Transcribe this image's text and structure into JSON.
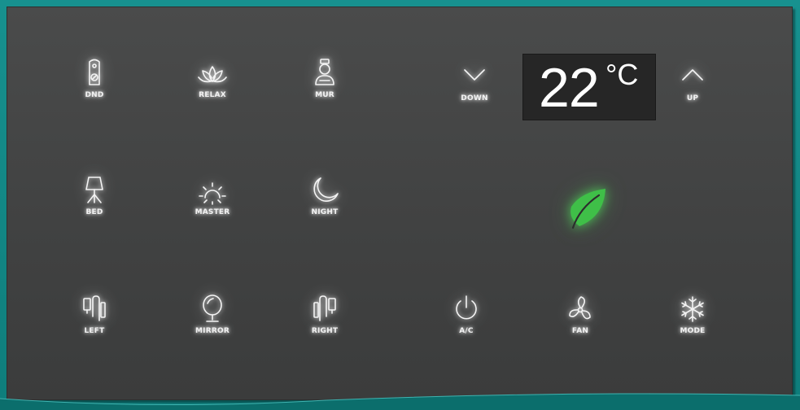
{
  "panel": {
    "lighting": {
      "dnd": {
        "label": "DND",
        "icon": "do-not-disturb-icon"
      },
      "relax": {
        "label": "RELAX",
        "icon": "lotus-icon"
      },
      "mur": {
        "label": "MUR",
        "icon": "housekeeping-icon"
      },
      "bed": {
        "label": "BED",
        "icon": "table-lamp-icon"
      },
      "master": {
        "label": "MASTER",
        "icon": "sun-icon"
      },
      "night": {
        "label": "NIGHT",
        "icon": "crescent-moon-icon"
      },
      "left": {
        "label": "LEFT",
        "icon": "wall-lamp-left-icon"
      },
      "mirror": {
        "label": "MIRROR",
        "icon": "mirror-icon"
      },
      "right": {
        "label": "RIGHT",
        "icon": "wall-lamp-right-icon"
      }
    },
    "climate": {
      "down": {
        "label": "DOWN",
        "icon": "chevron-down-icon"
      },
      "up": {
        "label": "UP",
        "icon": "chevron-up-icon"
      },
      "temperature": {
        "value": "22",
        "unit": "°C"
      },
      "eco": {
        "icon": "leaf-icon",
        "color": "#3fbf48"
      },
      "ac": {
        "label": "A/C",
        "icon": "power-icon"
      },
      "fan": {
        "label": "FAN",
        "icon": "fan-icon"
      },
      "mode": {
        "label": "MODE",
        "icon": "snowflake-icon"
      }
    }
  },
  "colors": {
    "background": "#17918f",
    "panel": "#444545",
    "glow": "#ffffff",
    "eco_leaf": "#3fbf48"
  }
}
